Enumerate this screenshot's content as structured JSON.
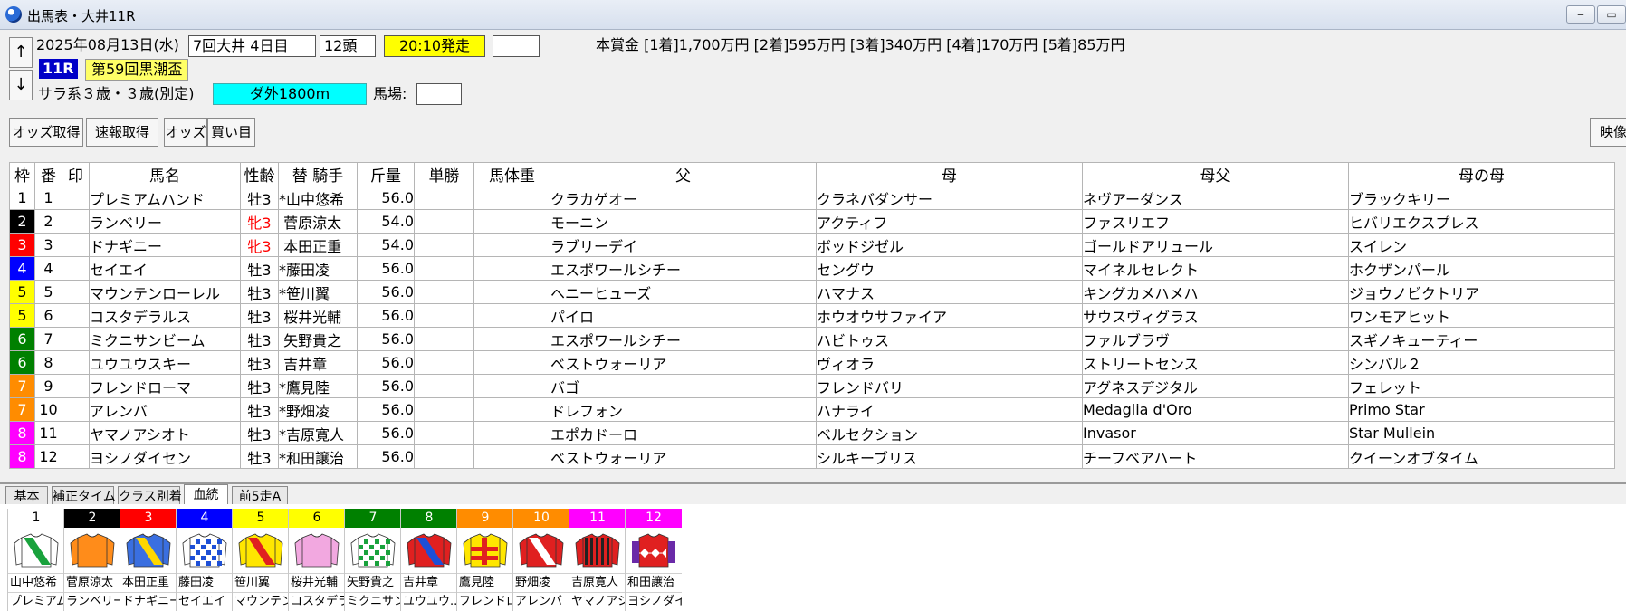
{
  "window": {
    "title": "出馬表・大井11R",
    "minimize": "‒",
    "maximize": "▭"
  },
  "race": {
    "date": "2025年08月13日(水)",
    "meeting": "7回大井 4日目",
    "runners": "12頭",
    "post_time": "20:10発走",
    "race_no": "11R",
    "race_name": "第59回黒潮盃",
    "conditions": "サラ系３歳・３歳(別定)",
    "course": "ダ外1800m",
    "track_label": "馬場:",
    "prize_money": "本賞金 [1着]1,700万円 [2着]595万円 [3着]340万円 [4着]170万円 [5着]85万円"
  },
  "nav": {
    "up": "↑",
    "down": "↓"
  },
  "toolbar": {
    "odds_fetch": "オッズ取得",
    "quick_fetch": "速報取得",
    "odds": "オッズ",
    "bets": "買い目",
    "video": "映像"
  },
  "colors": {
    "frame": {
      "1": {
        "bg": "#ffffff",
        "fg": "#000000"
      },
      "2": {
        "bg": "#000000",
        "fg": "#ffffff"
      },
      "3": {
        "bg": "#ff0000",
        "fg": "#ffffff"
      },
      "4": {
        "bg": "#0000ff",
        "fg": "#ffffff"
      },
      "5": {
        "bg": "#ffff00",
        "fg": "#000000"
      },
      "6": {
        "bg": "#008000",
        "fg": "#ffffff"
      },
      "7": {
        "bg": "#ff8c00",
        "fg": "#ffffff"
      },
      "8": {
        "bg": "#ff00ff",
        "fg": "#ffffff"
      }
    },
    "post_time_bg": "#ffff00",
    "race_no_bg": "#0000c8",
    "race_name_bg": "#ffff66",
    "course_bg": "#00ffff",
    "filly": "#ff0000"
  },
  "table": {
    "headers": [
      "枠",
      "番",
      "印",
      "馬名",
      "性齢",
      "替 騎手",
      "斤量",
      "単勝",
      "馬体重",
      "父",
      "母",
      "母父",
      "母の母"
    ],
    "rows": [
      {
        "waku": "1",
        "ban": "1",
        "name": "プレミアムハンド",
        "sex_age": "牡3",
        "filly": false,
        "jockey": "*山中悠希",
        "weight": "56.0",
        "sire": "クラカゲオー",
        "dam": "クラネバダンサー",
        "damsire": "ネヴアーダンス",
        "damdam": "ブラックキリー"
      },
      {
        "waku": "2",
        "ban": "2",
        "name": "ランベリー",
        "sex_age": "牝3",
        "filly": true,
        "jockey": " 菅原涼太",
        "weight": "54.0",
        "sire": "モーニン",
        "dam": "アクティフ",
        "damsire": "ファスリエフ",
        "damdam": "ヒバリエクスプレス"
      },
      {
        "waku": "3",
        "ban": "3",
        "name": "ドナギニー",
        "sex_age": "牝3",
        "filly": true,
        "jockey": " 本田正重",
        "weight": "54.0",
        "sire": "ラブリーデイ",
        "dam": "ボッドジゼル",
        "damsire": "ゴールドアリュール",
        "damdam": "スイレン"
      },
      {
        "waku": "4",
        "ban": "4",
        "name": "セイエイ",
        "sex_age": "牡3",
        "filly": false,
        "jockey": "*藤田凌",
        "weight": "56.0",
        "sire": "エスポワールシチー",
        "dam": "セングウ",
        "damsire": "マイネルセレクト",
        "damdam": "ホクザンパール"
      },
      {
        "waku": "5",
        "ban": "5",
        "name": "マウンテンローレル",
        "sex_age": "牡3",
        "filly": false,
        "jockey": "*笹川翼",
        "weight": "56.0",
        "sire": "ヘニーヒューズ",
        "dam": "ハマナス",
        "damsire": "キングカメハメハ",
        "damdam": "ジョウノビクトリア"
      },
      {
        "waku": "5",
        "ban": "6",
        "name": "コスタデラルス",
        "sex_age": "牡3",
        "filly": false,
        "jockey": " 桜井光輔",
        "weight": "56.0",
        "sire": "パイロ",
        "dam": "ホウオウサファイア",
        "damsire": "サウスヴィグラス",
        "damdam": "ワンモアヒット"
      },
      {
        "waku": "6",
        "ban": "7",
        "name": "ミクニサンビーム",
        "sex_age": "牡3",
        "filly": false,
        "jockey": " 矢野貴之",
        "weight": "56.0",
        "sire": "エスポワールシチー",
        "dam": "ハビトゥス",
        "damsire": "ファルブラヴ",
        "damdam": "スギノキューティー"
      },
      {
        "waku": "6",
        "ban": "8",
        "name": "ユウユウスキー",
        "sex_age": "牡3",
        "filly": false,
        "jockey": " 吉井章",
        "weight": "56.0",
        "sire": "ベストウォーリア",
        "dam": "ヴィオラ",
        "damsire": "ストリートセンス",
        "damdam": "シンバル２"
      },
      {
        "waku": "7",
        "ban": "9",
        "name": "フレンドローマ",
        "sex_age": "牡3",
        "filly": false,
        "jockey": "*鷹見陸",
        "weight": "56.0",
        "sire": "バゴ",
        "dam": "フレンドバリ",
        "damsire": "アグネスデジタル",
        "damdam": "フェレット"
      },
      {
        "waku": "7",
        "ban": "10",
        "name": "アレンバ",
        "sex_age": "牡3",
        "filly": false,
        "jockey": "*野畑凌",
        "weight": "56.0",
        "sire": "ドレフォン",
        "dam": "ハナライ",
        "damsire": "Medaglia d'Oro",
        "damdam": "Primo Star"
      },
      {
        "waku": "8",
        "ban": "11",
        "name": "ヤマノアシオト",
        "sex_age": "牡3",
        "filly": false,
        "jockey": "*吉原寛人",
        "weight": "56.0",
        "sire": "エポカドーロ",
        "dam": "ベルセクション",
        "damsire": "Invasor",
        "damdam": "Star Mullein"
      },
      {
        "waku": "8",
        "ban": "12",
        "name": "ヨシノダイセン",
        "sex_age": "牡3",
        "filly": false,
        "jockey": "*和田譲治",
        "weight": "56.0",
        "sire": "ベストウォーリア",
        "dam": "シルキーブリス",
        "damsire": "チーフベアハート",
        "damdam": "クイーンオブタイム"
      }
    ]
  },
  "tabs": [
    "基本",
    "補正タイム",
    "クラス別着",
    "血統",
    "前5走A"
  ],
  "active_tab": "血統",
  "silks": [
    {
      "num": "1",
      "jockey": "山中悠希",
      "horse": "プレミアム",
      "body": "#ffffff",
      "accent": "#19a23c",
      "pattern": "sash"
    },
    {
      "num": "2",
      "jockey": "菅原涼太",
      "horse": "ランベリー",
      "body": "#ff8c1a",
      "accent": "#ff8c1a",
      "pattern": "plain"
    },
    {
      "num": "3",
      "jockey": "本田正重",
      "horse": "ドナギニー",
      "body": "#3a6fe0",
      "accent": "#ffd700",
      "pattern": "sash"
    },
    {
      "num": "4",
      "jockey": "藤田凌",
      "horse": "セイエイ",
      "body": "#ffffff",
      "accent": "#1d4fd6",
      "pattern": "check"
    },
    {
      "num": "5",
      "jockey": "笹川翼",
      "horse": "マウンテン",
      "body": "#ffe600",
      "accent": "#e02020",
      "pattern": "sash"
    },
    {
      "num": "6",
      "jockey": "桜井光輔",
      "horse": "コスタデラ",
      "body": "#f2a8e0",
      "accent": "#f2a8e0",
      "pattern": "plain"
    },
    {
      "num": "7",
      "jockey": "矢野貴之",
      "horse": "ミクニサン",
      "body": "#ffffff",
      "accent": "#19a23c",
      "pattern": "check"
    },
    {
      "num": "8",
      "jockey": "吉井章",
      "horse": "ユウユウ...",
      "body": "#e02020",
      "accent": "#1d4fd6",
      "pattern": "sash"
    },
    {
      "num": "9",
      "jockey": "鷹見陸",
      "horse": "フレンドロ",
      "body": "#ffe600",
      "accent": "#e02020",
      "pattern": "cross"
    },
    {
      "num": "10",
      "jockey": "野畑凌",
      "horse": "アレンバ",
      "body": "#e02020",
      "accent": "#ffffff",
      "pattern": "sash"
    },
    {
      "num": "11",
      "jockey": "吉原寛人",
      "horse": "ヤマノアシ",
      "body": "#e02020",
      "accent": "#222222",
      "pattern": "stripes"
    },
    {
      "num": "12",
      "jockey": "和田譲治",
      "horse": "ヨシノダイ",
      "body": "#e02020",
      "accent": "#6a2aa8",
      "pattern": "zigzag"
    }
  ]
}
